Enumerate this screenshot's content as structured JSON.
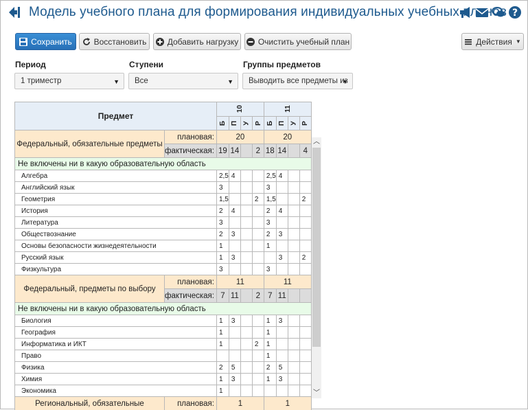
{
  "header": {
    "title": "Модель учебного плана для формирования индивидуальных учебных планов",
    "icon_color": "#1e5a8e"
  },
  "toolbar": {
    "save_label": "Сохранить",
    "restore_label": "Восстановить",
    "add_load_label": "Добавить нагрузку",
    "clear_label": "Очистить учебный план",
    "actions_label": "Действия"
  },
  "filters": {
    "period_label": "Период",
    "period_value": "1 триместр",
    "stages_label": "Ступени",
    "stages_value": "Все",
    "groups_label": "Группы предметов",
    "groups_value": "Выводить все предметы из"
  },
  "table": {
    "subject_header": "Предмет",
    "grades": [
      "10",
      "11"
    ],
    "sub_cols": [
      "Б",
      "П",
      "У",
      "Р"
    ],
    "plan_label": "плановая:",
    "fact_label": "фактическая:",
    "area_none": "Не включены ни в какую образовательную область",
    "sections": [
      {
        "title": "Федеральный, обязательные предметы",
        "plan": [
          "20",
          "20"
        ],
        "fact": [
          [
            "19",
            "14",
            "",
            "2"
          ],
          [
            "18",
            "14",
            "",
            "4"
          ]
        ],
        "subjects": [
          {
            "name": "Алгебра",
            "v": [
              "2,5",
              "4",
              "",
              "",
              "2,5",
              "4",
              "",
              ""
            ]
          },
          {
            "name": "Английский язык",
            "v": [
              "3",
              "",
              "",
              "",
              "3",
              "",
              "",
              ""
            ]
          },
          {
            "name": "Геометрия",
            "v": [
              "1,5",
              "",
              "",
              "2",
              "1,5",
              "",
              "",
              "2"
            ]
          },
          {
            "name": "История",
            "v": [
              "2",
              "4",
              "",
              "",
              "2",
              "4",
              "",
              ""
            ]
          },
          {
            "name": "Литература",
            "v": [
              "3",
              "",
              "",
              "",
              "3",
              "",
              "",
              ""
            ]
          },
          {
            "name": "Обществознание",
            "v": [
              "2",
              "3",
              "",
              "",
              "2",
              "3",
              "",
              ""
            ]
          },
          {
            "name": "Основы безопасности жизнедеятельности",
            "v": [
              "1",
              "",
              "",
              "",
              "1",
              "",
              "",
              ""
            ]
          },
          {
            "name": "Русский язык",
            "v": [
              "1",
              "3",
              "",
              "",
              "",
              "3",
              "",
              "2"
            ]
          },
          {
            "name": "Физкультура",
            "v": [
              "3",
              "",
              "",
              "",
              "3",
              "",
              "",
              ""
            ]
          }
        ]
      },
      {
        "title": "Федеральный, предметы по выбору",
        "plan": [
          "11",
          "11"
        ],
        "fact": [
          [
            "7",
            "11",
            "",
            "2"
          ],
          [
            "7",
            "11",
            "",
            ""
          ]
        ],
        "subjects": [
          {
            "name": "Биология",
            "v": [
              "1",
              "3",
              "",
              "",
              "1",
              "3",
              "",
              ""
            ]
          },
          {
            "name": "География",
            "v": [
              "1",
              "",
              "",
              "",
              "1",
              "",
              "",
              ""
            ]
          },
          {
            "name": "Информатика и ИКТ",
            "v": [
              "1",
              "",
              "",
              "2",
              "1",
              "",
              "",
              ""
            ]
          },
          {
            "name": "Право",
            "v": [
              "",
              "",
              "",
              "",
              "1",
              "",
              "",
              ""
            ]
          },
          {
            "name": "Физика",
            "v": [
              "2",
              "5",
              "",
              "",
              "2",
              "5",
              "",
              ""
            ]
          },
          {
            "name": "Химия",
            "v": [
              "1",
              "3",
              "",
              "",
              "1",
              "3",
              "",
              ""
            ]
          },
          {
            "name": "Экономика",
            "v": [
              "1",
              "",
              "",
              "",
              "",
              "",
              "",
              ""
            ]
          }
        ]
      },
      {
        "title": "Региональный, обязательные",
        "plan": [
          "1",
          "1"
        ],
        "fact": null,
        "subjects": []
      }
    ]
  }
}
